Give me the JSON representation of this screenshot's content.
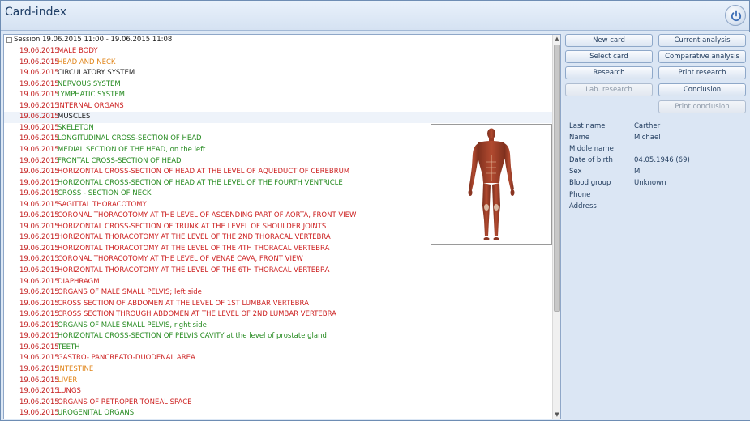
{
  "window": {
    "title": "Card-index"
  },
  "tree": {
    "session_label": "Session 19.06.2015 11:00 - 19.06.2015 11:08",
    "rows": [
      {
        "date": "19.06.2015",
        "name": "MALE BODY",
        "color": "red"
      },
      {
        "date": "19.06.2015",
        "name": "HEAD AND NECK",
        "color": "orange"
      },
      {
        "date": "19.06.2015",
        "name": "CIRCULATORY SYSTEM",
        "color": "black"
      },
      {
        "date": "19.06.2015",
        "name": "NERVOUS SYSTEM",
        "color": "green"
      },
      {
        "date": "19.06.2015",
        "name": "LYMPHATIC SYSTEM",
        "color": "green"
      },
      {
        "date": "19.06.2015",
        "name": "INTERNAL ORGANS",
        "color": "red"
      },
      {
        "date": "19.06.2015",
        "name": "MUSCLES",
        "color": "black",
        "selected": true
      },
      {
        "date": "19.06.2015",
        "name": "SKELETON",
        "color": "green"
      },
      {
        "date": "19.06.2015",
        "name": "LONGITUDINAL CROSS-SECTION OF HEAD",
        "color": "green"
      },
      {
        "date": "19.06.2015",
        "name": "MEDIAL SECTION OF THE HEAD, on the left",
        "color": "green"
      },
      {
        "date": "19.06.2015",
        "name": "FRONTAL CROSS-SECTION OF HEAD",
        "color": "green"
      },
      {
        "date": "19.06.2015",
        "name": "HORIZONTAL CROSS-SECTION OF HEAD AT THE LEVEL OF AQUEDUCT OF CEREBRUM",
        "color": "red"
      },
      {
        "date": "19.06.2015",
        "name": "HORIZONTAL CROSS-SECTION OF HEAD AT THE LEVEL OF THE FOURTH VENTRICLE",
        "color": "green"
      },
      {
        "date": "19.06.2015",
        "name": "CROSS - SECTION  OF   NECK",
        "color": "green"
      },
      {
        "date": "19.06.2015",
        "name": "SAGITTAL THORACOTOMY",
        "color": "red"
      },
      {
        "date": "19.06.2015",
        "name": "CORONAL THORACOTOMY AT THE LEVEL OF ASCENDING PART OF AORTA, FRONT VIEW",
        "color": "red"
      },
      {
        "date": "19.06.2015",
        "name": "HORIZONTAL CROSS-SECTION OF TRUNK AT THE LEVEL OF SHOULDER JOINTS",
        "color": "red"
      },
      {
        "date": "19.06.2015",
        "name": "HORIZONTAL THORACOTOMY AT THE LEVEL OF THE 2ND THORACAL VERTEBRA",
        "color": "red"
      },
      {
        "date": "19.06.2015",
        "name": "HORIZONTAL THORACOTOMY AT THE LEVEL OF THE 4TH THORACAL VERTEBRA",
        "color": "red"
      },
      {
        "date": "19.06.2015",
        "name": "CORONAL THORACOTOMY AT THE LEVEL OF VENAE CAVA, FRONT VIEW",
        "color": "red"
      },
      {
        "date": "19.06.2015",
        "name": "HORIZONTAL THORACOTOMY AT THE LEVEL OF THE 6TH THORACAL VERTEBRA",
        "color": "red"
      },
      {
        "date": "19.06.2015",
        "name": "DIAPHRAGM",
        "color": "red"
      },
      {
        "date": "19.06.2015",
        "name": "ORGANS OF MALE SMALL PELVIS; left side",
        "color": "red"
      },
      {
        "date": "19.06.2015",
        "name": "CROSS SECTION OF ABDOMEN AT THE LEVEL OF 1ST LUMBAR VERTEBRA",
        "color": "red"
      },
      {
        "date": "19.06.2015",
        "name": "CROSS SECTION THROUGH ABDOMEN AT THE LEVEL OF 2ND LUMBAR VERTEBRA",
        "color": "red"
      },
      {
        "date": "19.06.2015",
        "name": "ORGANS OF MALE SMALL PELVIS, right side",
        "color": "green"
      },
      {
        "date": "19.06.2015",
        "name": "HORIZONTAL CROSS-SECTION OF PELVIS CAVITY at the level of prostate gland",
        "color": "green"
      },
      {
        "date": "19.06.2015",
        "name": "TEETH",
        "color": "green"
      },
      {
        "date": "19.06.2015",
        "name": "GASTRO- PANCREATO-DUODENAL AREA",
        "color": "red"
      },
      {
        "date": "19.06.2015",
        "name": "INTESTINE",
        "color": "orange"
      },
      {
        "date": "19.06.2015",
        "name": "LIVER",
        "color": "orange"
      },
      {
        "date": "19.06.2015",
        "name": "LUNGS",
        "color": "red"
      },
      {
        "date": "19.06.2015",
        "name": "ORGANS OF RETROPERITONEAL SPACE",
        "color": "red"
      },
      {
        "date": "19.06.2015",
        "name": "UROGENITAL ORGANS",
        "color": "green"
      }
    ]
  },
  "buttons": {
    "new_card": "New card",
    "current_analysis": "Current analysis",
    "select_card": "Select card",
    "comparative_analysis": "Comparative analysis",
    "research": "Research",
    "print_research": "Print research",
    "lab_research": "Lab. research",
    "conclusion": "Conclusion",
    "print_conclusion": "Print conclusion"
  },
  "patient": {
    "last_name_label": "Last name",
    "last_name": "Carther",
    "name_label": "Name",
    "name": "Michael",
    "middle_name_label": "Middle name",
    "middle_name": "",
    "dob_label": "Date of birth",
    "dob": "04.05.1946 (69)",
    "sex_label": "Sex",
    "sex": "M",
    "blood_group_label": "Blood group",
    "blood_group": "Unknown",
    "phone_label": "Phone",
    "phone": "",
    "address_label": "Address",
    "address": ""
  },
  "colors": {
    "red": "#cc1f1f",
    "green": "#258a1f",
    "orange": "#e08418",
    "black": "#1a1a1a",
    "accent": "#1e395b"
  },
  "icons": {
    "power": "power-icon",
    "collapse": "collapse-minus-icon",
    "scroll_up": "arrow-up-icon",
    "scroll_down": "arrow-down-icon"
  }
}
